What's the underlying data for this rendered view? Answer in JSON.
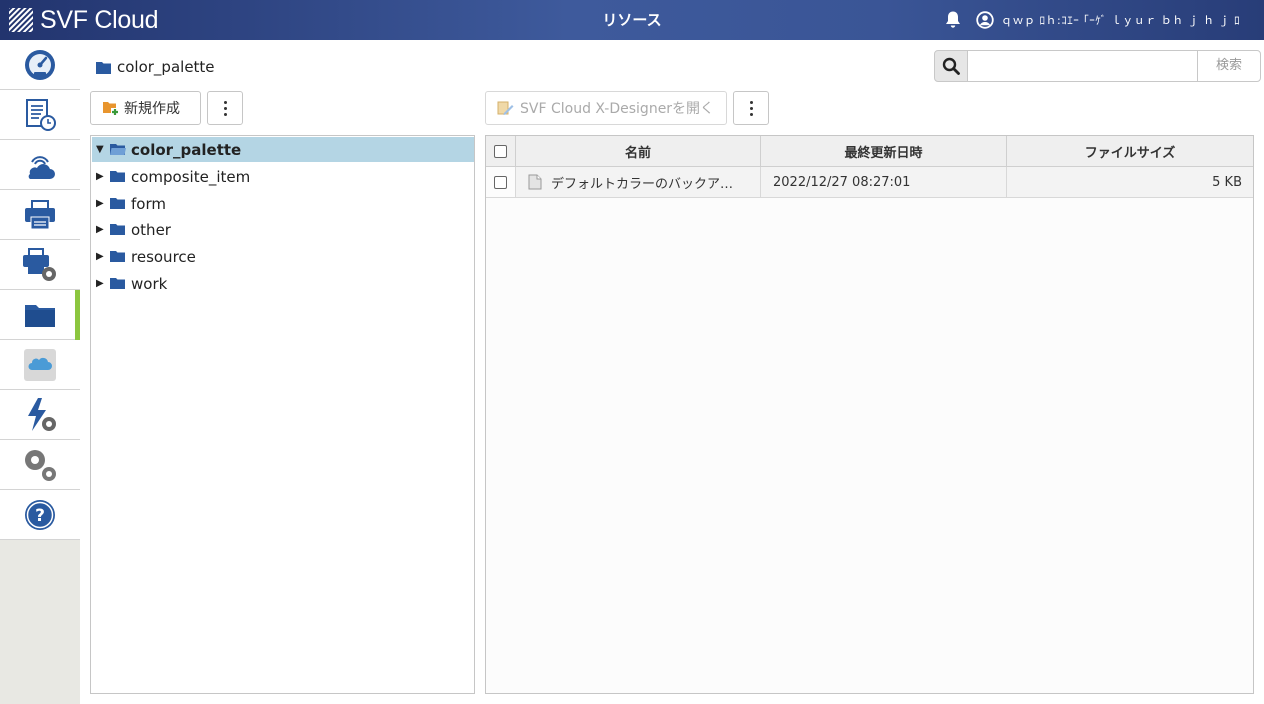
{
  "app": {
    "logo_text": "SVF Cloud",
    "title": "リソース",
    "user_display": "ｑｗｐ ﾛｈ:ｺｴｰ ｢ｰｹﾞ  ｌｙｕｒ ｂｈ ｊ ｈ ｊ ﾛ"
  },
  "nav": {
    "items": [
      {
        "icon": "dashboard-gauge-icon"
      },
      {
        "icon": "report-schedule-icon"
      },
      {
        "icon": "cloud-wifi-icon"
      },
      {
        "icon": "printer-icon"
      },
      {
        "icon": "printer-settings-icon"
      },
      {
        "icon": "folder-icon",
        "active": true
      },
      {
        "icon": "salesforce-cloud-icon"
      },
      {
        "icon": "bolt-settings-icon"
      },
      {
        "icon": "gears-icon"
      },
      {
        "icon": "help-icon"
      }
    ]
  },
  "breadcrumb": {
    "current": "color_palette"
  },
  "search": {
    "value": "",
    "placeholder": "",
    "button_label": "検索"
  },
  "toolbar_left": {
    "new_label": "新規作成"
  },
  "toolbar_right": {
    "designer_label": "SVF Cloud X-Designerを開く"
  },
  "tree": {
    "items": [
      {
        "label": "color_palette",
        "expanded": true,
        "selected": true
      },
      {
        "label": "composite_item",
        "expanded": false
      },
      {
        "label": "form",
        "expanded": false
      },
      {
        "label": "other",
        "expanded": false
      },
      {
        "label": "resource",
        "expanded": false
      },
      {
        "label": "work",
        "expanded": false
      }
    ]
  },
  "table": {
    "headers": {
      "name": "名前",
      "modified": "最終更新日時",
      "size": "ファイルサイズ"
    },
    "rows": [
      {
        "name": "デフォルトカラーのバックア…",
        "modified": "2022/12/27 08:27:01",
        "size": "5 KB"
      }
    ]
  },
  "colors": {
    "header_start": "#22346e",
    "header_mid": "#3e5a9c",
    "accent_active": "#8cc63f",
    "tree_selected": "#b4d5e4",
    "icon_blue": "#2a5aa0"
  }
}
